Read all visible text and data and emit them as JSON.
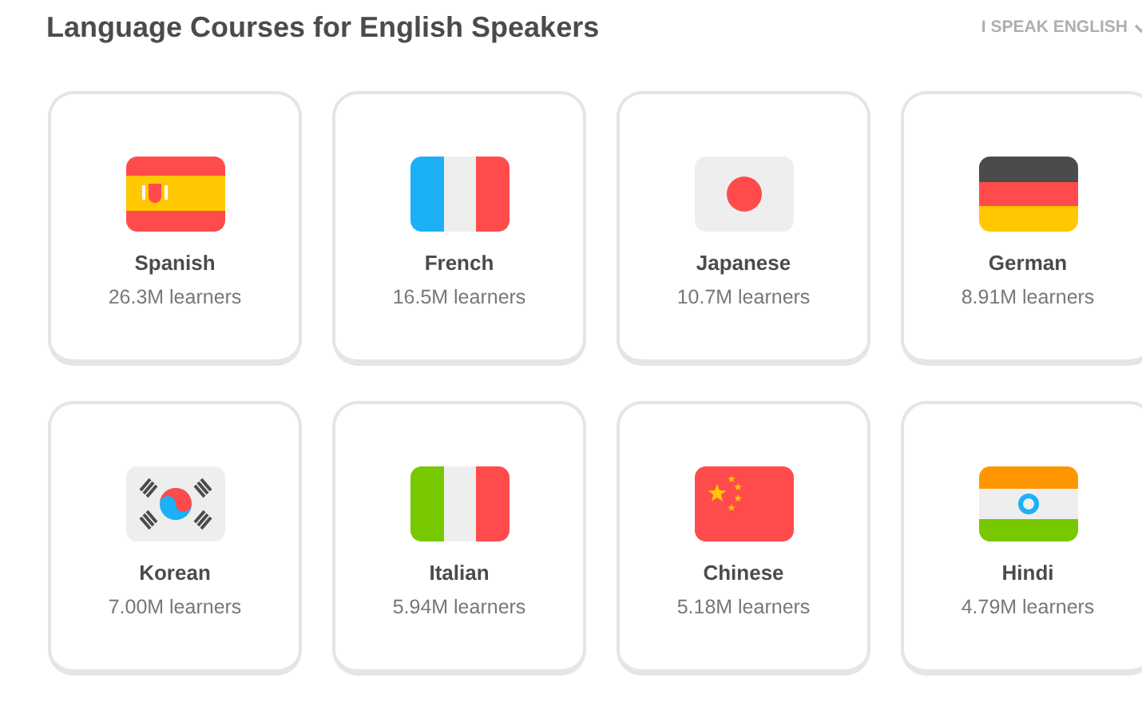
{
  "header": {
    "title": "Language Courses for English Speakers",
    "language_menu": "I SPEAK ENGLISH"
  },
  "courses": [
    {
      "kind": "spain",
      "name": "Spanish",
      "learners": "26.3M learners"
    },
    {
      "kind": "france",
      "name": "French",
      "learners": "16.5M learners"
    },
    {
      "kind": "japan",
      "name": "Japanese",
      "learners": "10.7M learners"
    },
    {
      "kind": "germany",
      "name": "German",
      "learners": "8.91M learners"
    },
    {
      "kind": "korea",
      "name": "Korean",
      "learners": "7.00M learners"
    },
    {
      "kind": "italy",
      "name": "Italian",
      "learners": "5.94M learners"
    },
    {
      "kind": "china",
      "name": "Chinese",
      "learners": "5.18M learners"
    },
    {
      "kind": "india",
      "name": "Hindi",
      "learners": "4.79M learners"
    }
  ]
}
